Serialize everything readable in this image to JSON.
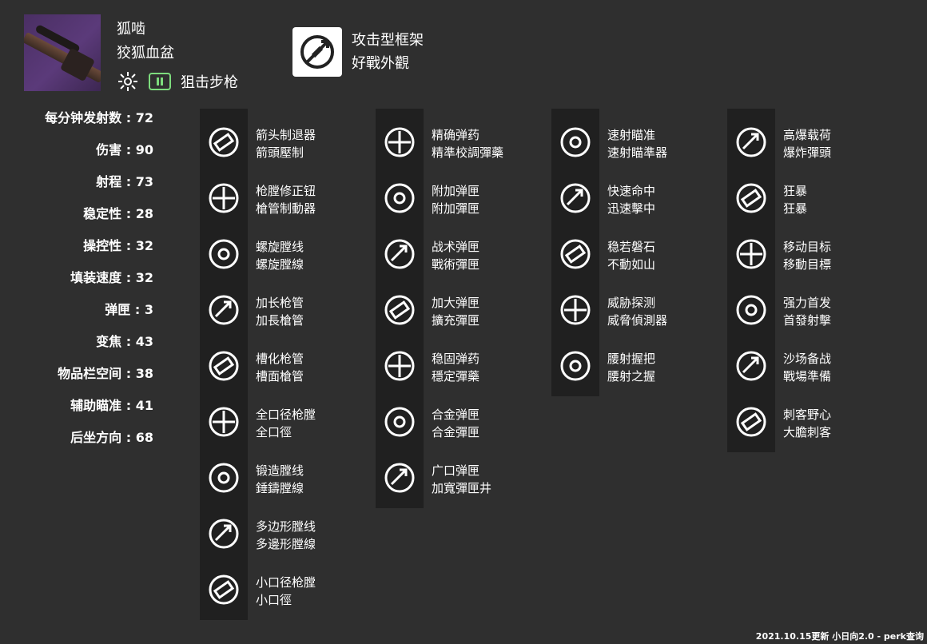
{
  "weapon": {
    "name": "狐啮",
    "subname": "狡狐血盆",
    "type": "狙击步枪",
    "element_icon": "solar-burst-icon",
    "ammo_icon": "special-ammo-icon"
  },
  "frame": {
    "icon": "aggressive-frame-icon",
    "name_simplified": "攻击型框架",
    "name_traditional": "好戰外觀"
  },
  "stats": [
    {
      "label": "每分钟发射数",
      "value": "72"
    },
    {
      "label": "伤害",
      "value": "90"
    },
    {
      "label": "射程",
      "value": "73"
    },
    {
      "label": "稳定性",
      "value": "28"
    },
    {
      "label": "操控性",
      "value": "32"
    },
    {
      "label": "填装速度",
      "value": "32"
    },
    {
      "label": "弹匣",
      "value": "3"
    },
    {
      "label": "变焦",
      "value": "43"
    },
    {
      "label": "物品栏空间",
      "value": "38"
    },
    {
      "label": "辅助瞄准",
      "value": "41"
    },
    {
      "label": "后坐方向",
      "value": "68"
    }
  ],
  "columns": [
    {
      "perks": [
        {
          "s": "箭头制退器",
          "t": "箭頭壓制",
          "icon": "arrowhead-brake-icon"
        },
        {
          "s": "枪膛修正钮",
          "t": "槍管制動器",
          "icon": "corkscrew-rifling-icon"
        },
        {
          "s": "螺旋膛线",
          "t": "螺旋膛線",
          "icon": "spiral-rifling-icon"
        },
        {
          "s": "加长枪管",
          "t": "加長槍管",
          "icon": "extended-barrel-icon"
        },
        {
          "s": "槽化枪管",
          "t": "槽面槍管",
          "icon": "fluted-barrel-icon"
        },
        {
          "s": "全口径枪膛",
          "t": "全口徑",
          "icon": "full-bore-icon"
        },
        {
          "s": "锻造膛线",
          "t": "錘鑄膛線",
          "icon": "hammer-forged-icon"
        },
        {
          "s": "多边形膛线",
          "t": "多邊形膛線",
          "icon": "polygonal-rifling-icon"
        },
        {
          "s": "小口径枪膛",
          "t": "小口徑",
          "icon": "smallbore-icon"
        }
      ]
    },
    {
      "perks": [
        {
          "s": "精确弹药",
          "t": "精準校調彈藥",
          "icon": "accurized-rounds-icon"
        },
        {
          "s": "附加弹匣",
          "t": "附加彈匣",
          "icon": "appended-mag-icon"
        },
        {
          "s": "战术弹匣",
          "t": "戰術彈匣",
          "icon": "tactical-mag-icon"
        },
        {
          "s": "加大弹匣",
          "t": "擴充彈匣",
          "icon": "extended-mag-icon"
        },
        {
          "s": "稳固弹药",
          "t": "穩定彈藥",
          "icon": "steady-rounds-icon"
        },
        {
          "s": "合金弹匣",
          "t": "合金彈匣",
          "icon": "alloy-mag-icon"
        },
        {
          "s": "广口弹匣",
          "t": "加寬彈匣井",
          "icon": "flared-magwell-icon"
        }
      ]
    },
    {
      "perks": [
        {
          "s": "速射瞄准",
          "t": "速射瞄準器",
          "icon": "snapshot-sights-icon"
        },
        {
          "s": "快速命中",
          "t": "迅速擊中",
          "icon": "rapid-hit-icon"
        },
        {
          "s": "稳若磐石",
          "t": "不動如山",
          "icon": "unflinching-icon"
        },
        {
          "s": "威胁探测",
          "t": "威脅偵測器",
          "icon": "threat-detector-icon"
        },
        {
          "s": "腰射握把",
          "t": "腰射之握",
          "icon": "hip-fire-grip-icon"
        }
      ]
    },
    {
      "perks": [
        {
          "s": "高爆载荷",
          "t": "爆炸彈頭",
          "icon": "explosive-payload-icon"
        },
        {
          "s": "狂暴",
          "t": "狂暴",
          "icon": "rampage-icon"
        },
        {
          "s": "移动目标",
          "t": "移動目標",
          "icon": "moving-target-icon"
        },
        {
          "s": "强力首发",
          "t": "首發射擊",
          "icon": "opening-shot-icon"
        },
        {
          "s": "沙场备战",
          "t": "戰場準備",
          "icon": "field-prep-icon"
        },
        {
          "s": "刺客野心",
          "t": "大膽刺客",
          "icon": "assassins-ambition-icon"
        }
      ]
    }
  ],
  "footer": "2021.10.15更新 小日向2.0 - perk查询"
}
